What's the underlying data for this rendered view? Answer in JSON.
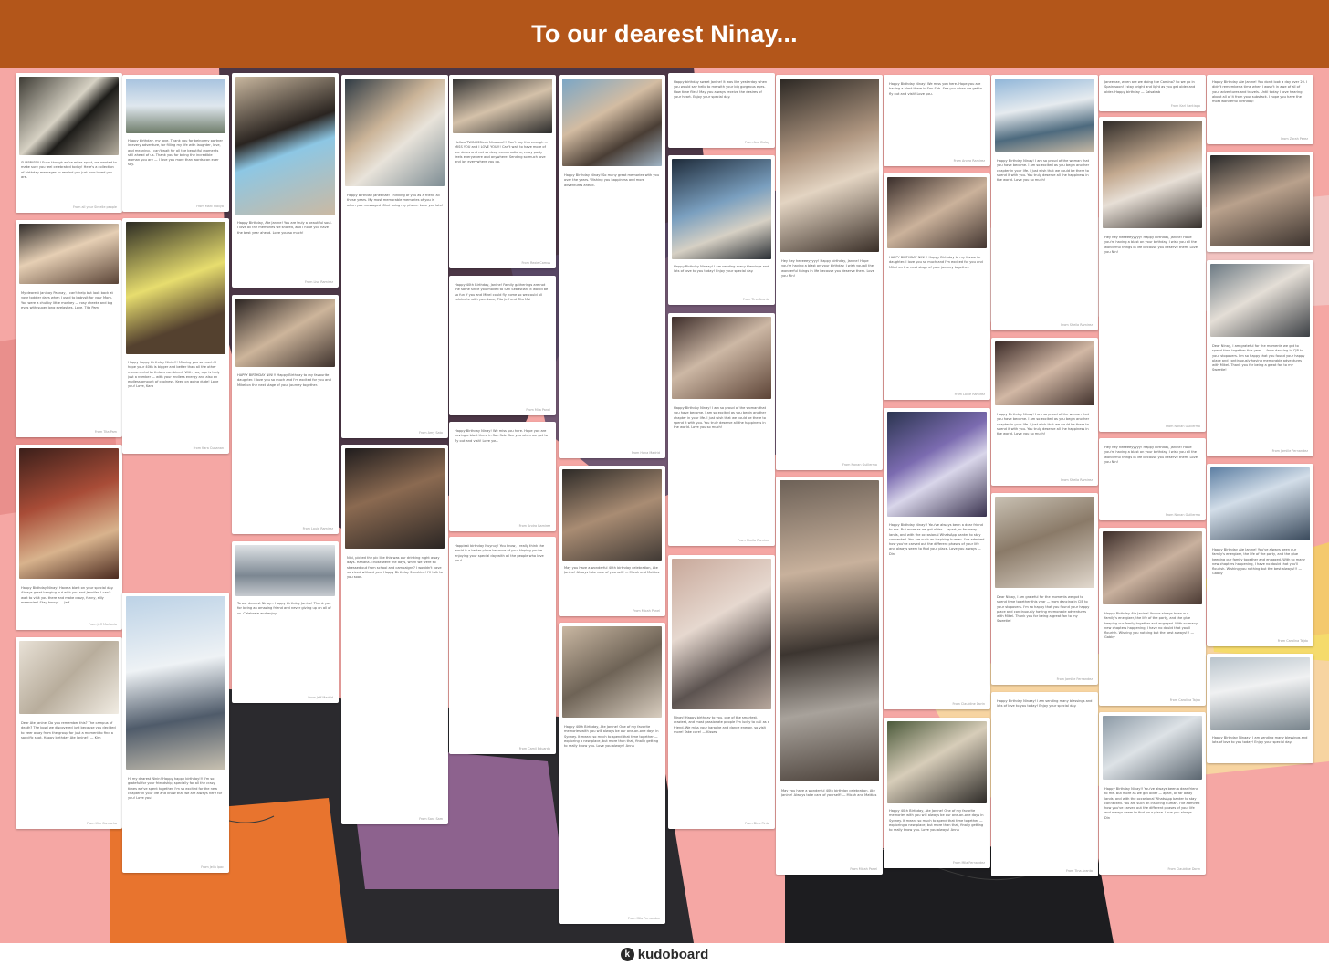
{
  "board": {
    "title": "To our dearest Ninay...",
    "footer_brand": "kudoboard",
    "footer_icon": "kudoboard-logo-icon"
  },
  "posts": [
    {
      "from": "From all your Sinjelle people",
      "text": "SURPRISE!!! Even though we're miles apart, we wanted to make sure you feel celebrated today! Here's a collection of birthday messages to remind you just how loved you are."
    },
    {
      "from": "From Marc Mallya",
      "text": "Happy birthday, my love. Thank you for being my partner in every adventure, for filling my life with laughter, love, and meaning. I can't wait for all the beautiful moments still ahead of us. Thank you for being the incredible woman you are — I love you more than words can ever say."
    },
    {
      "from": "From Lisa Ramirez",
      "text": "Happy Birthday, Ate Janine! You are truly a beautiful soul. I love all the memories we shared, and I hope you have the best year ahead. Love you so much!"
    },
    {
      "from": "From Rexie Camus",
      "text": "Hellow TWINSSSiesh Ninaaaa!!! Can't say this enough — I MISS YOU and I LOVE YOU!!! Can't wait to have more of our dates and not so deep conversations, crazy party feels everywhere and anywhere. Sending so much love and joy everywhere you go."
    },
    {
      "from": "From Ana Dulay",
      "text": "Happy birthday sweet Janine! It was like yesterday when you would say hello to me with your big gorgeous eyes. How time flies! May you always receive the desires of your heart. Enjoy your special day."
    },
    {
      "from": "From Andra Ramirez",
      "text": "Happy Birthday Ninay! We miss you here. Hope you are having a blast there in San Seb. See you when we get to fly out and visit! Love you."
    },
    {
      "from": "From Karl Santiago",
      "text": "Janeenae, when are we doing the Camino? So we go in Spain soon! I stay bright and light as you get older and older. Happy birthday — Kalsabab"
    },
    {
      "from": "From Zarah Perez",
      "text": "Happy Birthday Ate Janine! You don't look a day over 20. I didn't remember a time when I wasn't in awe of all of your adventures and travels. Until today I love hearing about all of it from your substack. I hope you have the most wonderful birthday!"
    },
    {
      "from": "From Tita Pam",
      "text": "My dearest Janinay Pannay, I can't help but look back at your toddler days when I used to babysit for your Mom. You were a chubby little monkey — rosy cheeks and big eyes with super long eyelashes. Love, Tita Pam"
    },
    {
      "from": "From Kara Cunanan",
      "text": "Happy happy birthday Ninin!!! Missing you so much! I hope your 40th is bigger and better than all the other monumental birthdays combined! With you, age is truly just a number — with your endless energy and also an endless amount of coolness. Keep on going dude! Love you! Love, Kara"
    },
    {
      "from": "From Louie Ramirez",
      "text": "HAPPY BIRTHDAY NIN!!! Happy Birthday to my favourite daughter. I love you so much and I'm excited for you and Mikel on the next stage of your journey together."
    },
    {
      "from": "From Jeff Madrid",
      "text": "To our dearest Ninay... Happy birthday Janine! Thank you for being an amazing friend and never giving up on all of us. Celebrate and enjoy!"
    },
    {
      "from": "From Mila Panel",
      "text": "Happy 40th Birthday, Janine! Family gatherings are not the same since you moved to San Sebastian. It would be so fun if you and Mikel could fly home so we could all celebrate with you. Love, Tito Jeff and Tita Mai"
    },
    {
      "from": "From Amy Sato",
      "text": "Happy Birthday Janeenae! Thinking of you as a friend all these years. My most memorable memories of you is when you messaged Mikel using my phone. Love you lots!"
    },
    {
      "from": "From Camil Eduardo",
      "text": "Happiest birthday Nuynuy! You know, I really think the world is a better place because of you. Hoping you're enjoying your special day with all the people who love you!"
    },
    {
      "from": "From Hana Madrid",
      "text": "Happy Birthday Ninay! So many great memories with you over the years. Wishing you happiness and more adventures ahead."
    },
    {
      "from": "From Sheila Ramirez",
      "text": "Happy Birthday Ninay! I am so proud of the woman that you have become. I am so excited as you begin another chapter in your life. I just wish that we could be there to spend it with you. You truly deserve all the happiness in the world. Love you so much!"
    },
    {
      "from": "From Nonan Guillermo",
      "text": "Hey hey heeeeeyyyyy! Happy birthday, Janine! Hope you're having a blast on your birthday. I wish you all the wonderful things in life because you deserve them. Love you Nin!"
    },
    {
      "from": "From Jamille Fernandez",
      "text": "Dear Ninay, I am grateful for the moments we got to spend time together this year — from dancing in CJB to your stopovers. I'm so happy that you found your happy place and continuously having memorable adventures with Mikel. Thank you for being a great fan to my Sweetie!"
    },
    {
      "from": "From Jeff Mortanio",
      "text": "Happy Birthday Ninay! Have a blast on your special day. Always great hanging out with you and Jennifer. I can't wait to visit you there and make crazy, funny, silly memories! Stay bossy! — Jeff"
    },
    {
      "from": "From Kim Camacho",
      "text": "Dear Ate Janine, Do you remember this? The campus of death? The bowl we discovered just because you decided to veer away from the group for just a moment to find a specific spot. Happy birthday Ate Janine!! — Kim"
    },
    {
      "from": "From Jelia Ipac",
      "text": "Hi my dearest Ninin! Happy happy birthday!!! I'm so grateful for your friendship, specially for all the crazy times we've spent together. I'm so excited for the new chapter in your life and know that we are always here for you! Love you!"
    },
    {
      "from": "From Bobby Canson",
      "text": "Sorry about this video message, as usual I'm rambling and babbling. Can't believe you're turning 40, so fast! Not only that, you're going to be a mom too! Happy birthday Janine!"
    },
    {
      "from": "From Sara Sam",
      "text": "Nini, picked the pic like this was our drinking night away days. Hahaha. Those were the days, when we were so stressed out from school and campaigns? I wouldn't have survived without you. Happy Birthday Sunshine! I'll talk to you soon."
    },
    {
      "from": "From Mila Fernandez",
      "text": "Happy 40th Birthday, Ate Janine! One of my favorite memories with you will always be our one-on-one days in Sydney. It meant so much to spend that time together — exploring a new place, but more than that, finally getting to really know you. Love you always! Anna"
    },
    {
      "from": "From Dina Pinto",
      "text": "Ninay! Happy birthday to you, one of the smartest, craziest, and most passionate people I'm lucky to call as a friend. We miss your karaoke and dance energy, so visit more! Take care! — Kisses"
    },
    {
      "from": "From Micah Panel",
      "text": "May you have a wonderful 40th birthday celebration, Ate Janine! Always take care of yourself! — Micah and Mattias"
    },
    {
      "from": "From Tina Aranta",
      "text": "Happy Birthday Ninaay! I am sending many blessings and lots of love to you today! Enjoy your special day."
    },
    {
      "from": "From Clauidine Dorin",
      "text": "Happy Birthday Ninay!! You've always been a dear friend to me. But more as we got older — apart, or far away lands, and with the occasional WhatsApp banter to stay connected. You are such an inspiring human. I've admired how you've carved out the different phases of your life and always seem to find your place. Love you always — Din"
    },
    {
      "from": "From Carolina Tajdo",
      "text": "Happy Birthday Ate Janine! You've always been our family's energizer, the life of the party, and the glue keeping our family together and engaged. With so many new chapters happening, I have no doubt that you'll flourish. Wishing you nothing but the best always!!! — Gabby"
    }
  ],
  "colors": {
    "header_bg": "#b3561a",
    "background": "#f5a7a4",
    "card_bg": "#ffffff"
  }
}
